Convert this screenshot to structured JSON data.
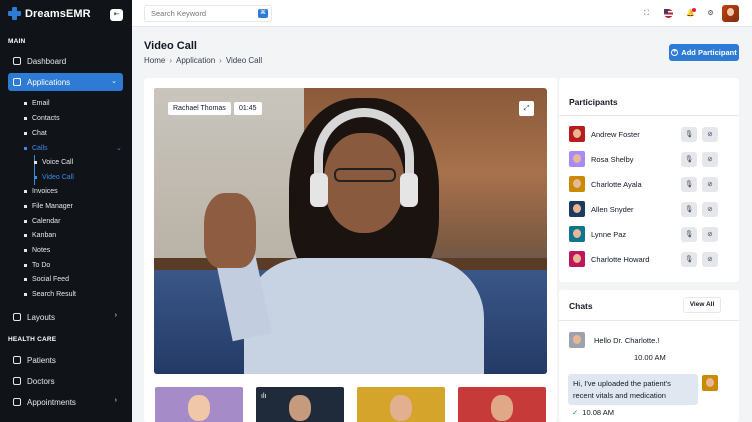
{
  "brand": {
    "name": "DreamsEMR",
    "accent": "#2e7bd6"
  },
  "sidebar": {
    "sections": {
      "main": "MAIN",
      "healthcare": "HEALTH CARE"
    },
    "items": {
      "dashboard": "Dashboard",
      "applications": "Applications",
      "layouts": "Layouts",
      "patients": "Patients",
      "doctors": "Doctors",
      "appointments": "Appointments"
    },
    "applications_sub": {
      "email": "Email",
      "contacts": "Contacts",
      "chat": "Chat",
      "calls": "Calls",
      "voice_call": "Voice Call",
      "video_call": "Video Call",
      "invoices": "Invoices",
      "file_manager": "File Manager",
      "calendar": "Calendar",
      "kanban": "Kanban",
      "notes": "Notes",
      "todo": "To Do",
      "social_feed": "Social Feed",
      "search_result": "Search Result"
    }
  },
  "header": {
    "search_placeholder": "Search Keyword"
  },
  "page": {
    "title": "Video Call",
    "breadcrumb": [
      "Home",
      "Application",
      "Video Call"
    ],
    "add_button": "Add Participant"
  },
  "call": {
    "caller_name": "Rachael Thomas",
    "duration": "01:45"
  },
  "participants": {
    "title": "Participants",
    "list": [
      {
        "name": "Andrew Foster",
        "color": "#b91c1c"
      },
      {
        "name": "Rosa Shelby",
        "color": "#a78bfa"
      },
      {
        "name": "Charlotte Ayala",
        "color": "#ca8a04"
      },
      {
        "name": "Allen Snyder",
        "color": "#1e3a5f"
      },
      {
        "name": "Lynne Paz",
        "color": "#0e7490"
      },
      {
        "name": "Charlotte Howard",
        "color": "#be185d"
      }
    ]
  },
  "chats": {
    "title": "Chats",
    "view_all": "View All",
    "messages": [
      {
        "text": "Hello Dr. Charlotte.!",
        "time": "10.00 AM"
      },
      {
        "text": "Hi, I've uploaded the patient's recent vitals and medication",
        "time": "10.08 AM"
      }
    ]
  }
}
